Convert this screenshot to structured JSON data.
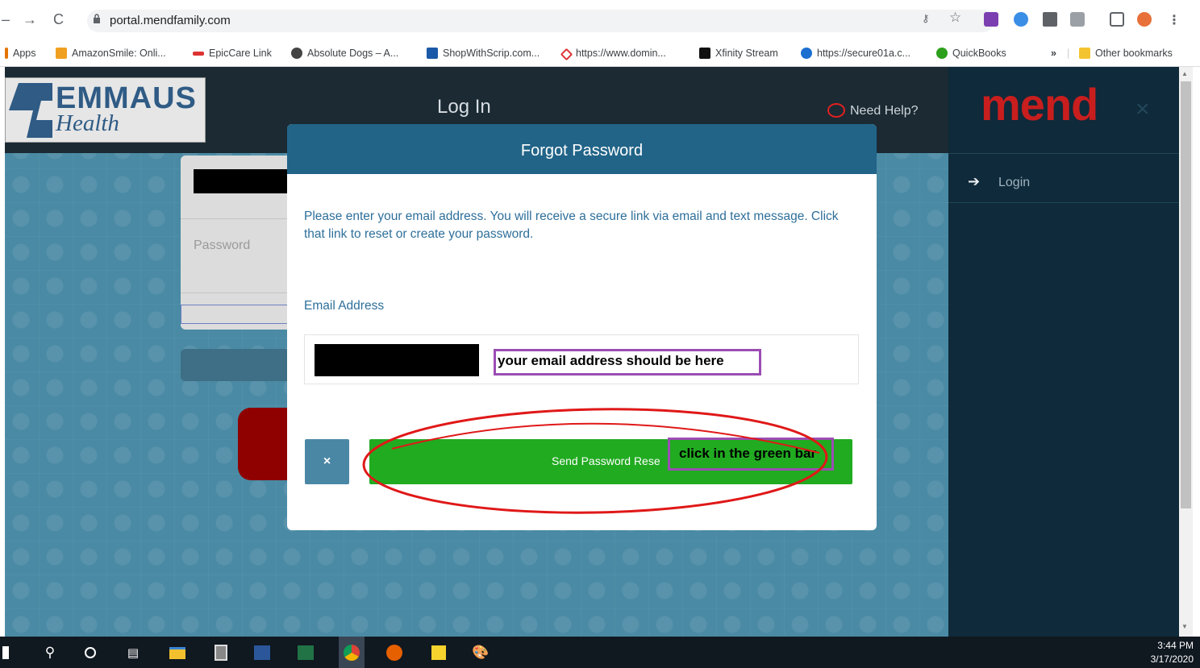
{
  "browser": {
    "url": "portal.mendfamily.com",
    "bookmarks": [
      {
        "label": "Apps",
        "icon": "apps-grid-icon"
      },
      {
        "label": "AmazonSmile: Onli...",
        "icon": "amazon-icon"
      },
      {
        "label": "EpicCare Link",
        "icon": "epic-icon"
      },
      {
        "label": "Absolute Dogs – A...",
        "icon": "globe-icon"
      },
      {
        "label": "ShopWithScrip.com...",
        "icon": "bag-icon"
      },
      {
        "label": "https://www.domin...",
        "icon": "pin-icon"
      },
      {
        "label": "Xfinity Stream",
        "icon": "xfinity-icon"
      },
      {
        "label": "https://secure01a.c...",
        "icon": "secure-icon"
      },
      {
        "label": "QuickBooks",
        "icon": "quickbooks-icon"
      }
    ],
    "more": "»",
    "other_bookmarks": "Other bookmarks"
  },
  "site": {
    "logo_brand": "EMMAUS",
    "logo_sub": "Health",
    "page_title": "Log In",
    "help": "Need Help?",
    "password_placeholder": "Password",
    "side_brand": "mend",
    "side_close": "×",
    "side_login": "Login"
  },
  "modal": {
    "title": "Forgot Password",
    "description": "Please enter your email address. You will receive a secure link via email and text message. Click that link to reset or create your password.",
    "email_label": "Email Address",
    "email_annotation": "your email address should be here",
    "cancel_symbol": "×",
    "send_label": "Send Password Rese",
    "send_annotation": "click in the green bar"
  },
  "colors": {
    "modal_header": "#226488",
    "send_button": "#21ab21",
    "annotation_box": "#9b4db3",
    "annotation_ellipse": "#e01818"
  },
  "taskbar": {
    "time": "3:44 PM",
    "date": "3/17/2020"
  }
}
